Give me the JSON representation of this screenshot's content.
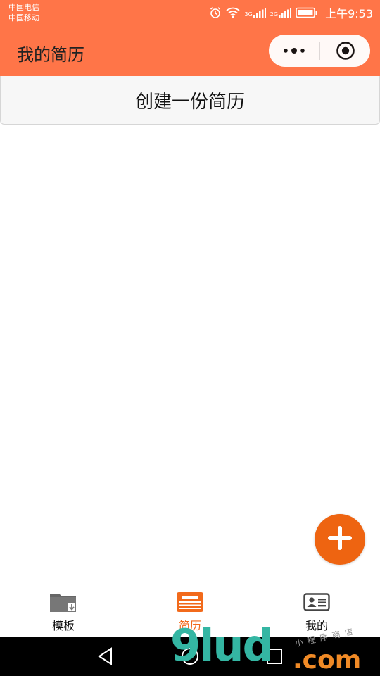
{
  "status_bar": {
    "carrier_1": "中国电信",
    "carrier_2": "中国移动",
    "network_1": "3G",
    "network_2": "2G",
    "time": "上午9:53",
    "icons": [
      "alarm-icon",
      "wifi-icon",
      "signal-3g-icon",
      "signal-2g-icon",
      "battery-icon"
    ]
  },
  "header": {
    "title": "我的简历",
    "more_icon": "more-dots-icon",
    "close_icon": "target-close-icon"
  },
  "main": {
    "create_button_label": "创建一份简历"
  },
  "fab": {
    "icon": "plus-icon"
  },
  "tabbar": {
    "active_index": 1,
    "items": [
      {
        "label": "模板",
        "icon": "folder-download-icon"
      },
      {
        "label": "简历",
        "icon": "resume-doc-icon"
      },
      {
        "label": "我的",
        "icon": "id-card-icon"
      }
    ]
  },
  "android_nav": {
    "icons": [
      "back-icon",
      "home-icon",
      "recents-icon"
    ]
  },
  "watermark": {
    "main": "9lud",
    "domain": ".com",
    "small": "小程序商店"
  },
  "colors": {
    "header": "#ff7548",
    "accent": "#ee6411",
    "active_tab": "#f26a1b",
    "watermark_teal": "#34b6a3",
    "watermark_orange": "#f08a26"
  }
}
